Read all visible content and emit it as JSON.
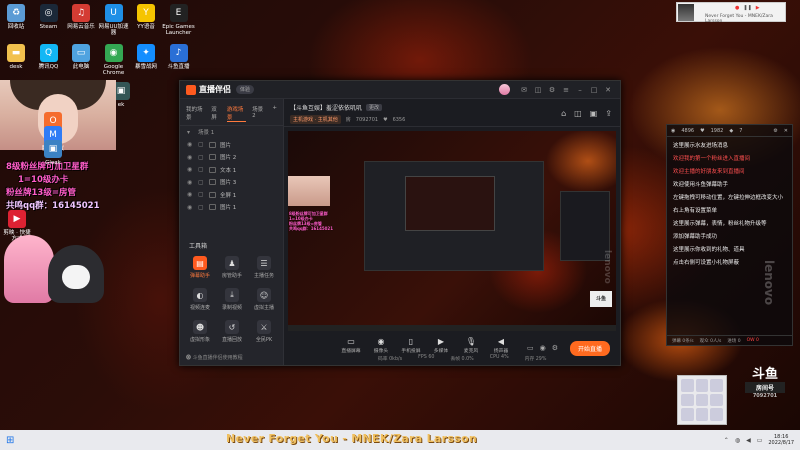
{
  "desktop": {
    "icons_row1": [
      {
        "label": "回收站",
        "icon": "recycle-bin-icon",
        "color": "#5b9bd5"
      },
      {
        "label": "Steam",
        "icon": "steam-icon",
        "color": "#1b2838"
      },
      {
        "label": "网易云音乐",
        "icon": "netease-music-icon",
        "color": "#d43c33"
      },
      {
        "label": "网易UU加速器",
        "icon": "uu-accelerator-icon",
        "color": "#1f8fe6"
      },
      {
        "label": "YY语音",
        "icon": "yy-voice-icon",
        "color": "#f5c400"
      },
      {
        "label": "Epic Games Launcher",
        "icon": "epic-games-icon",
        "color": "#222222"
      }
    ],
    "icons_row2": [
      {
        "label": "desk",
        "icon": "folder-icon",
        "color": "#f2c14e"
      },
      {
        "label": "腾讯QQ",
        "icon": "qq-icon",
        "color": "#12b7f5"
      },
      {
        "label": "此电脑",
        "icon": "this-pc-icon",
        "color": "#4fa3e0"
      },
      {
        "label": "Google Chrome",
        "icon": "chrome-icon",
        "color": "#34a853"
      },
      {
        "label": "暴雪战网",
        "icon": "battlenet-icon",
        "color": "#148eff"
      },
      {
        "label": "斗鱼直播",
        "icon": "music-app-icon",
        "color": "#2a6fd6"
      }
    ],
    "icons_left": [
      {
        "label": "Origin",
        "icon": "origin-icon",
        "color": "#f56c2d"
      },
      {
        "label": "腾讯会议",
        "icon": "meeting-icon",
        "color": "#2f7cf6"
      },
      {
        "label": "Gleek",
        "icon": "app-icon",
        "color": "#3b82c4"
      }
    ],
    "icon_misc": {
      "label": "ek"
    },
    "left_bottom_icon_label": "剪映 · 快捷方式",
    "overlay_lines": [
      "8级粉丝牌可加卫星群",
      "1=10级办卡",
      "粉丝牌13级=房管",
      "共鸣qq群：16145021"
    ]
  },
  "app": {
    "name": "直播伴侣",
    "version_chip": "体验",
    "scene_tabs": [
      "我的场景",
      "双屏",
      "游戏场景",
      "场景 2"
    ],
    "active_scene_tab": 2,
    "scene_header": "场景 1",
    "sources": [
      "图片",
      "图片 2",
      "文本 1",
      "图片 3",
      "全屏 1",
      "图片 1"
    ],
    "tools_title": "工具箱",
    "tools": [
      {
        "label": "弹幕助手",
        "icon": "danmaku-icon",
        "active": true
      },
      {
        "label": "房管助手",
        "icon": "admin-icon",
        "active": false
      },
      {
        "label": "主播任务",
        "icon": "task-icon",
        "active": false
      },
      {
        "label": "视频连麦",
        "icon": "video-link-icon",
        "active": false
      },
      {
        "label": "录制视频",
        "icon": "record-icon",
        "active": false
      },
      {
        "label": "虚拟主播",
        "icon": "vtuber-icon",
        "active": false
      },
      {
        "label": "虚拟形象",
        "icon": "avatar-icon",
        "active": false
      },
      {
        "label": "直播回放",
        "icon": "replay-icon",
        "active": false
      },
      {
        "label": "全民PK",
        "icon": "pk-icon",
        "active": false
      }
    ],
    "left_footer": "斗鱼直播伴侣使用教程",
    "room": {
      "title": "【斗鱼互娱】羞涩依依叽叽",
      "tag": "更改",
      "category": "主机游戏 · 主机其他",
      "room_no": "7092701",
      "fans": "6356"
    },
    "room_icons": [
      "home-icon",
      "shirt-icon",
      "bag-icon",
      "share-icon"
    ],
    "controls": [
      {
        "label": "直播屏幕",
        "icon": "screen-icon"
      },
      {
        "label": "摄像头",
        "icon": "camera-icon"
      },
      {
        "label": "手机投屏",
        "icon": "phone-cast-icon"
      },
      {
        "label": "多媒体",
        "icon": "media-icon"
      },
      {
        "label": "麦克风",
        "icon": "mic-icon"
      },
      {
        "label": "扬声器",
        "icon": "speaker-icon"
      }
    ],
    "start_button": "开始直播",
    "status": [
      "码率 0kb/s",
      "FPS 60",
      "丢帧 0.0%",
      "CPU 4%",
      "内存 29%"
    ]
  },
  "chat": {
    "header": [
      "4896",
      "1982",
      "7"
    ],
    "messages": [
      {
        "text": "这里展示水友进场消息",
        "highlight": false
      },
      {
        "text": "欢迎我的第一个粉丝进入直播间",
        "highlight": true
      },
      {
        "text": "欢迎主播的好朋友来到直播间",
        "highlight": true
      },
      {
        "text": "欢迎使用斗鱼弹幕助手",
        "highlight": false
      },
      {
        "text": "左键拖拽可移动位置，左键拉伸边框改变大小",
        "highlight": false
      },
      {
        "text": "右上角有设置菜单",
        "highlight": false
      },
      {
        "text": "这里展示弹幕，表情，粉丝礼物升级等",
        "highlight": false
      },
      {
        "text": "添加弹幕助手成功",
        "highlight": false
      },
      {
        "text": "这里展示你收到的礼物、道具",
        "highlight": false
      },
      {
        "text": "点击右侧可设置小礼物屏蔽",
        "highlight": false
      }
    ],
    "footer": [
      "弹幕 0条/s",
      "观众 0人/s",
      "进场 0",
      "OW 0"
    ]
  },
  "mini_player": {
    "title": "Never Forget You - MNEK/Zara Larsson"
  },
  "douyu_badge": {
    "logo": "斗鱼",
    "label": "房间号",
    "number": "7092701"
  },
  "watermark": "lenovo",
  "subtitle": "Never Forget You - MNEK/Zara Larsson",
  "taskbar": {
    "time": "18:16",
    "date": "2022/8/17",
    "colors": {
      "bg": "#e9eaee",
      "accent": "#1a73e8"
    }
  }
}
